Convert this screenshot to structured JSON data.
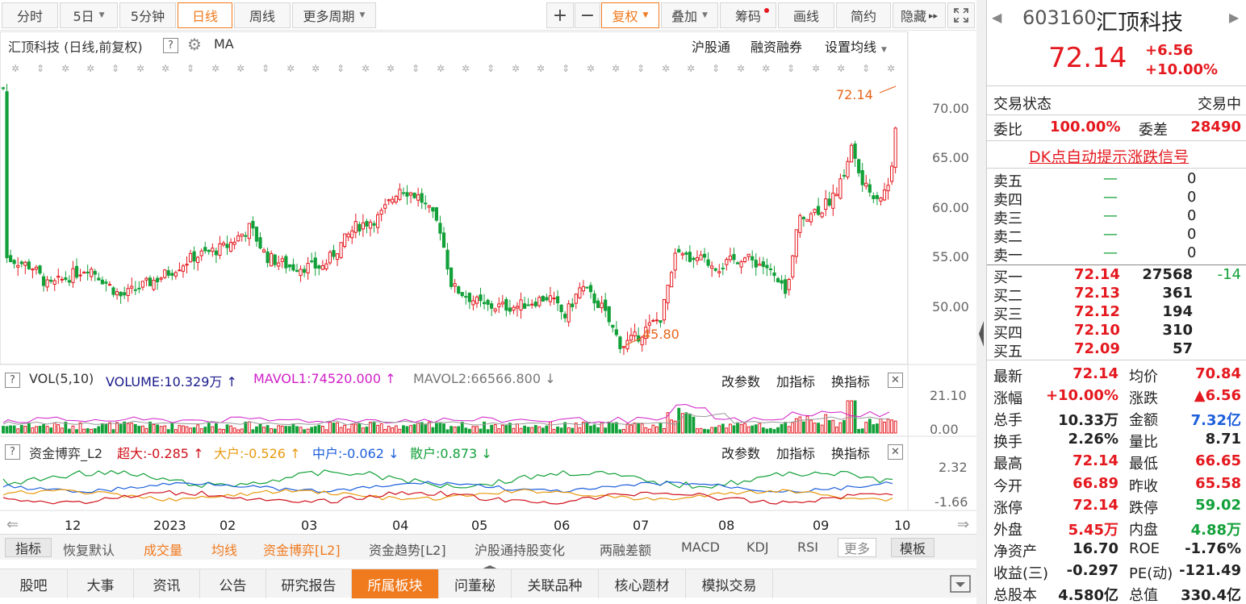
{
  "toolbar": {
    "items": [
      "分时",
      "5日",
      "5分钟",
      "日线",
      "周线",
      "更多周期",
      "复权",
      "叠加",
      "筹码",
      "画线",
      "简约",
      "隐藏"
    ],
    "plus": "+",
    "minus": "−",
    "more": "▸▸"
  },
  "main": {
    "title": "汇顶科技 (日线,前复权)",
    "help": "?",
    "ma": "MA",
    "links": [
      "沪股通",
      "融资融券",
      "设置均线"
    ],
    "price_ticks": [
      "70.00",
      "65.00",
      "60.00",
      "55.00",
      "50.00"
    ],
    "high_label": "72.14",
    "low_label": "45.80"
  },
  "vol": {
    "name": "VOL(5,10)",
    "volume": "VOLUME:10.329万",
    "mavol1": "MAVOL1:74520.000",
    "mavol2": "MAVOL2:66566.800",
    "ticks": [
      "21.10",
      "0.00"
    ],
    "actions": [
      "改参数",
      "加指标",
      "换指标"
    ],
    "close": "✕"
  },
  "fund": {
    "name": "资金博弈_L2",
    "super": "超大:-0.285",
    "big": "大户:-0.526",
    "mid": "中户:-0.062",
    "retail": "散户:0.873",
    "ticks": [
      "2.32",
      "-1.66"
    ],
    "actions": [
      "改参数",
      "加指标",
      "换指标"
    ],
    "close": "✕"
  },
  "xaxis": [
    "12",
    "2023",
    "02",
    "03",
    "04",
    "05",
    "06",
    "07",
    "08",
    "09",
    "10"
  ],
  "indicators": {
    "items": [
      "指标",
      "恢复默认",
      "成交量",
      "均线",
      "资金博弈[L2]",
      "资金趋势[L2]",
      "沪股通持股变化",
      "两融差额",
      "MACD",
      "KDJ",
      "RSI"
    ],
    "more": "更多",
    "template": "模板"
  },
  "bottom_tabs": [
    "股吧",
    "大事",
    "资讯",
    "公告",
    "研究报告",
    "所属板块",
    "问董秘",
    "关联品种",
    "核心题材",
    "模拟交易"
  ],
  "stock": {
    "code": "603160",
    "name": "汇顶科技",
    "price": "72.14",
    "change": "+6.56",
    "pct": "+10.00%",
    "status_label": "交易状态",
    "status_value": "交易中",
    "wb_label": "委比",
    "wb_value": "100.00%",
    "wc_label": "委差",
    "wc_value": "28490",
    "dk_signal": "DK点自动提示涨跌信号"
  },
  "sells": [
    {
      "label": "卖五",
      "price": "—",
      "vol": "0"
    },
    {
      "label": "卖四",
      "price": "—",
      "vol": "0"
    },
    {
      "label": "卖三",
      "price": "—",
      "vol": "0"
    },
    {
      "label": "卖二",
      "price": "—",
      "vol": "0"
    },
    {
      "label": "卖一",
      "price": "—",
      "vol": "0"
    }
  ],
  "buys": [
    {
      "label": "买一",
      "price": "72.14",
      "vol": "27568",
      "chg": "-14"
    },
    {
      "label": "买二",
      "price": "72.13",
      "vol": "361",
      "chg": ""
    },
    {
      "label": "买三",
      "price": "72.12",
      "vol": "194",
      "chg": ""
    },
    {
      "label": "买四",
      "price": "72.10",
      "vol": "310",
      "chg": ""
    },
    {
      "label": "买五",
      "price": "72.09",
      "vol": "57",
      "chg": ""
    }
  ],
  "stats": [
    [
      "最新",
      "72.14",
      "均价",
      "70.84"
    ],
    [
      "涨幅",
      "+10.00%",
      "涨跌",
      "▲6.56"
    ],
    [
      "总手",
      "10.33万",
      "金额",
      "7.32亿"
    ],
    [
      "换手",
      "2.26%",
      "量比",
      "8.71"
    ],
    [
      "最高",
      "72.14",
      "最低",
      "66.65"
    ],
    [
      "今开",
      "66.89",
      "昨收",
      "65.58"
    ],
    [
      "涨停",
      "72.14",
      "跌停",
      "59.02"
    ],
    [
      "外盘",
      "5.45万",
      "内盘",
      "4.88万"
    ],
    [
      "净资产",
      "16.70",
      "ROE",
      "-1.76%"
    ],
    [
      "收益(三)",
      "-0.297",
      "PE(动)",
      "-121.49"
    ],
    [
      "总股本",
      "4.580亿",
      "总值",
      "330.4亿"
    ]
  ],
  "colors": {
    "up": "#e4181e",
    "down": "#12a039",
    "accent": "#f07a1e",
    "blue": "#1d5fdc"
  }
}
